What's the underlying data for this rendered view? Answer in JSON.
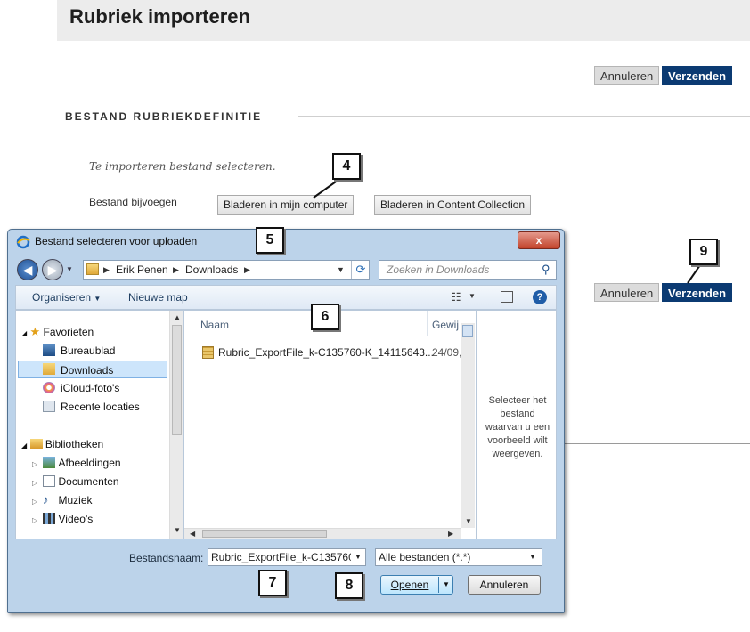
{
  "page": {
    "title": "Rubriek importeren",
    "cancel_label": "Annuleren",
    "submit_label": "Verzenden",
    "section_heading": "BESTAND RUBRIEKDEFINITIE",
    "instruction": "Te importeren bestand selecteren.",
    "attach_label": "Bestand bijvoegen",
    "browse_computer_label": "Bladeren in mijn computer",
    "browse_collection_label": "Bladeren in Content Collection",
    "colors": {
      "submit_bg": "#0b3a72",
      "header_bg": "#ececec"
    }
  },
  "callouts": [
    "4",
    "5",
    "6",
    "7",
    "8",
    "9"
  ],
  "dialog": {
    "title": "Bestand selecteren voor uploaden",
    "close_label": "x",
    "breadcrumb": [
      "Erik Penen",
      "Downloads"
    ],
    "search_placeholder": "Zoeken in Downloads",
    "toolbar": {
      "organize_label": "Organiseren",
      "new_folder_label": "Nieuwe map"
    },
    "nav": {
      "favorites_label": "Favorieten",
      "favorites": [
        "Bureaublad",
        "Downloads",
        "iCloud-foto's",
        "Recente locaties"
      ],
      "libraries_label": "Bibliotheken",
      "libraries": [
        "Afbeeldingen",
        "Documenten",
        "Muziek",
        "Video's"
      ]
    },
    "columns": {
      "name": "Naam",
      "modified": "Gewij"
    },
    "files": [
      {
        "name": "Rubric_ExportFile_k-C135760-K_14115643...",
        "date": "24/09,"
      }
    ],
    "preview_text": "Selecteer het bestand waarvan u een voorbeeld wilt weergeven.",
    "filename_label": "Bestandsnaam:",
    "filename_value": "Rubric_ExportFile_k-C135760-",
    "filter_value": "Alle bestanden (*.*)",
    "open_label": "Openen",
    "cancel_label": "Annuleren"
  }
}
